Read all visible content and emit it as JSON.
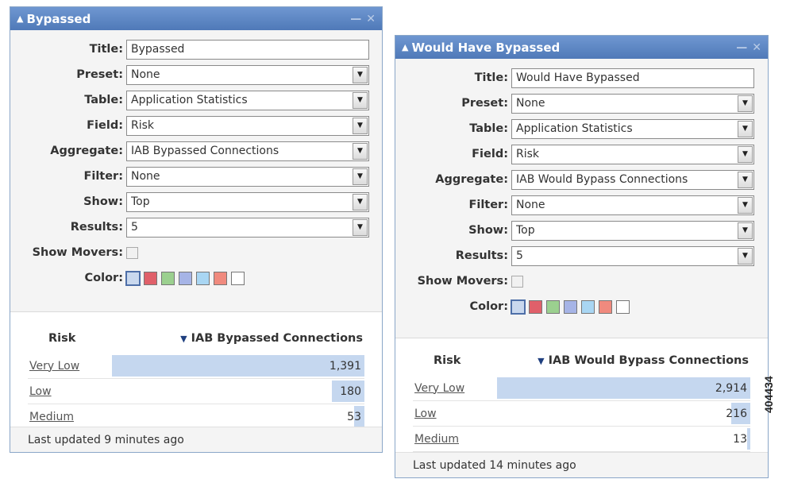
{
  "widgets": [
    {
      "title": "Bypassed",
      "form": {
        "title_label": "Title:",
        "title_value": "Bypassed",
        "preset_label": "Preset:",
        "preset_value": "None",
        "table_label": "Table:",
        "table_value": "Application Statistics",
        "field_label": "Field:",
        "field_value": "Risk",
        "aggregate_label": "Aggregate:",
        "aggregate_value": "IAB Bypassed Connections",
        "filter_label": "Filter:",
        "filter_value": "None",
        "show_label": "Show:",
        "show_value": "Top",
        "results_label": "Results:",
        "results_value": "5",
        "movers_label": "Show Movers:",
        "color_label": "Color:"
      },
      "results": {
        "col_label": "Risk",
        "col_value": "IAB Bypassed Connections",
        "rows": [
          {
            "name": "Very Low",
            "value": "1,391",
            "fraction": 1.0
          },
          {
            "name": "Low",
            "value": "180",
            "fraction": 0.13
          },
          {
            "name": "Medium",
            "value": "53",
            "fraction": 0.04
          }
        ]
      },
      "footer": "Last updated 9 minutes ago"
    },
    {
      "title": "Would Have Bypassed",
      "form": {
        "title_label": "Title:",
        "title_value": "Would Have Bypassed",
        "preset_label": "Preset:",
        "preset_value": "None",
        "table_label": "Table:",
        "table_value": "Application Statistics",
        "field_label": "Field:",
        "field_value": "Risk",
        "aggregate_label": "Aggregate:",
        "aggregate_value": "IAB Would Bypass Connections",
        "filter_label": "Filter:",
        "filter_value": "None",
        "show_label": "Show:",
        "show_value": "Top",
        "results_label": "Results:",
        "results_value": "5",
        "movers_label": "Show Movers:",
        "color_label": "Color:"
      },
      "results": {
        "col_label": "Risk",
        "col_value": "IAB Would Bypass Connections",
        "rows": [
          {
            "name": "Very Low",
            "value": "2,914",
            "fraction": 1.0
          },
          {
            "name": "Low",
            "value": "216",
            "fraction": 0.074
          },
          {
            "name": "Medium",
            "value": "13",
            "fraction": 0.0045
          }
        ]
      },
      "footer": "Last updated 14 minutes ago"
    }
  ],
  "colors": [
    "#c9d8ee",
    "#e0606a",
    "#9bd08f",
    "#a6b4e6",
    "#a9d6f3",
    "#f08a7e",
    "#ffffff"
  ],
  "icons": {
    "collapse": "caret-up-icon",
    "minimize": "minimize-icon",
    "close": "close-icon",
    "dropdown": "dropdown-arrow-icon",
    "sort": "sort-desc-icon"
  },
  "figure_id": "404434"
}
